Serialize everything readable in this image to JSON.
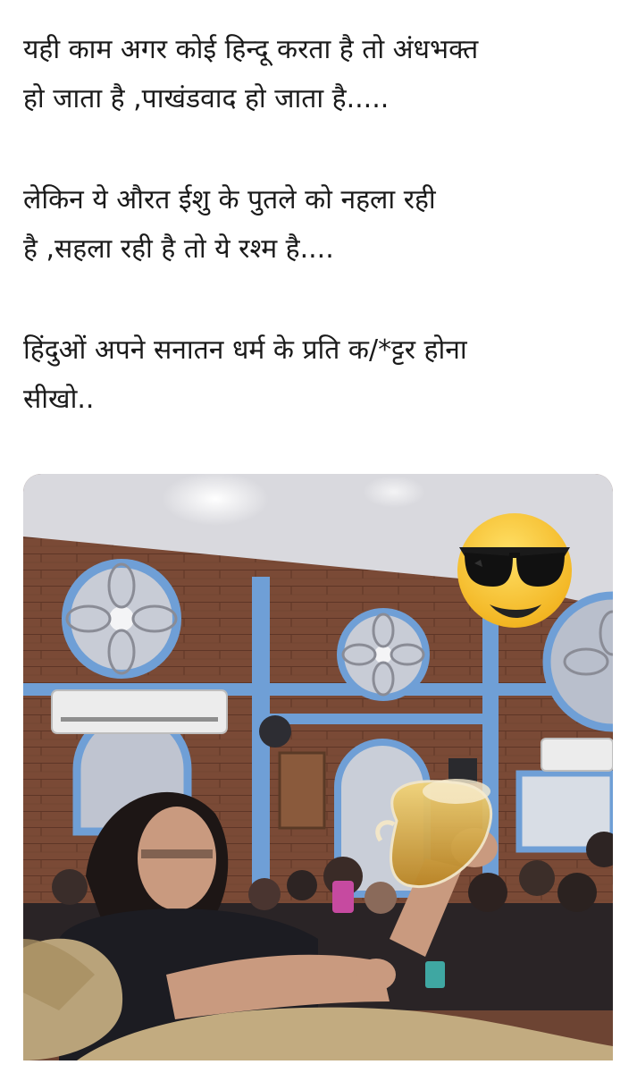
{
  "post": {
    "paragraphs": [
      {
        "line1": "यही काम अगर कोई हिन्दू करता है तो अंधभक्त",
        "line2": "हो जाता है ,पाखंडवाद हो जाता है....."
      },
      {
        "line1": "लेकिन ये औरत ईशु के पुतले को नहला रही",
        "line2": "है ,सहला रही है तो ये रश्म है...."
      },
      {
        "line1": "हिंदुओं अपने सनातन धर्म के प्रति क/*ट्टर होना",
        "line2": "सीखो.."
      }
    ]
  },
  "media": {
    "emoji": "sunglasses-smiley",
    "colors": {
      "brick_wall": "#7a4a36",
      "ceiling": "#d9d9de",
      "frame_blue": "#6f9fd6",
      "emoji_yellow": "#f7c530",
      "liquid": "#d6a43b"
    }
  }
}
